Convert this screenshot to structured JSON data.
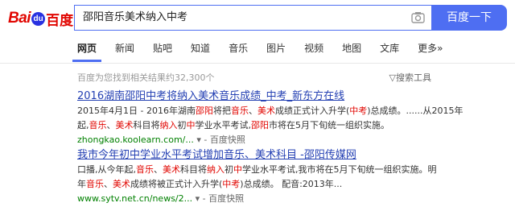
{
  "header": {
    "logo": {
      "left": "Bai",
      "paw": "du",
      "right": "百度"
    },
    "search_query": "邵阳音乐美术纳入中考",
    "search_button": "百度一下",
    "camera_icon": "camera-icon",
    "accent_color": "#4e6ef2"
  },
  "tabs": [
    "网页",
    "新闻",
    "贴吧",
    "知道",
    "音乐",
    "图片",
    "视频",
    "地图",
    "文库",
    "更多»"
  ],
  "info": {
    "count": "百度为您找到相关结果约32,300个",
    "tools": "搜索工具"
  },
  "results": [
    {
      "title": [
        {
          "t": "2016湖南邵阳中考将纳入美术音乐成绩_中考_新东方在线",
          "k": false
        }
      ],
      "abstract1": [
        {
          "t": "2015年4月1日 - 2016年湖南",
          "k": false
        },
        {
          "t": "邵阳",
          "k": true
        },
        {
          "t": "将把",
          "k": false
        },
        {
          "t": "音乐",
          "k": true
        },
        {
          "t": "、",
          "k": false
        },
        {
          "t": "美术",
          "k": true
        },
        {
          "t": "成绩正式计入升学(",
          "k": false
        },
        {
          "t": "中考",
          "k": true
        },
        {
          "t": ")总成绩。......从2015年",
          "k": false
        }
      ],
      "abstract2": [
        {
          "t": "起,",
          "k": false
        },
        {
          "t": "音乐",
          "k": true
        },
        {
          "t": "、",
          "k": false
        },
        {
          "t": "美术",
          "k": true
        },
        {
          "t": "科目将",
          "k": false
        },
        {
          "t": "纳入",
          "k": true
        },
        {
          "t": "初",
          "k": false
        },
        {
          "t": "中",
          "k": true
        },
        {
          "t": "学业水平考试,",
          "k": false
        },
        {
          "t": "邵阳",
          "k": true
        },
        {
          "t": "市将在5月下旬统一组织实施。",
          "k": false
        }
      ],
      "url": "zhongkao.koolearn.com/...",
      "cache": "百度快照"
    },
    {
      "title": [
        {
          "t": "我市今年初中学业水平考试增加音乐、美术科目 -邵阳传媒网",
          "k": false
        }
      ],
      "abstract1": [
        {
          "t": "口播,从今年起,",
          "k": false
        },
        {
          "t": "音乐",
          "k": true
        },
        {
          "t": "、",
          "k": false
        },
        {
          "t": "美术",
          "k": true
        },
        {
          "t": "科目将",
          "k": false
        },
        {
          "t": "纳入",
          "k": true
        },
        {
          "t": "初",
          "k": false
        },
        {
          "t": "中",
          "k": true
        },
        {
          "t": "学业水平考试,我市将在5月下旬统一组织实施。明",
          "k": false
        }
      ],
      "abstract2": [
        {
          "t": "年",
          "k": false
        },
        {
          "t": "音乐",
          "k": true
        },
        {
          "t": "、",
          "k": false
        },
        {
          "t": "美术",
          "k": true
        },
        {
          "t": "成绩将被正式计入升学(",
          "k": false
        },
        {
          "t": "中考",
          "k": true
        },
        {
          "t": ")总成绩。 配音:2013年...",
          "k": false
        }
      ],
      "url": "www.sytv.net.cn/news/2...",
      "cache": "百度快照"
    }
  ]
}
